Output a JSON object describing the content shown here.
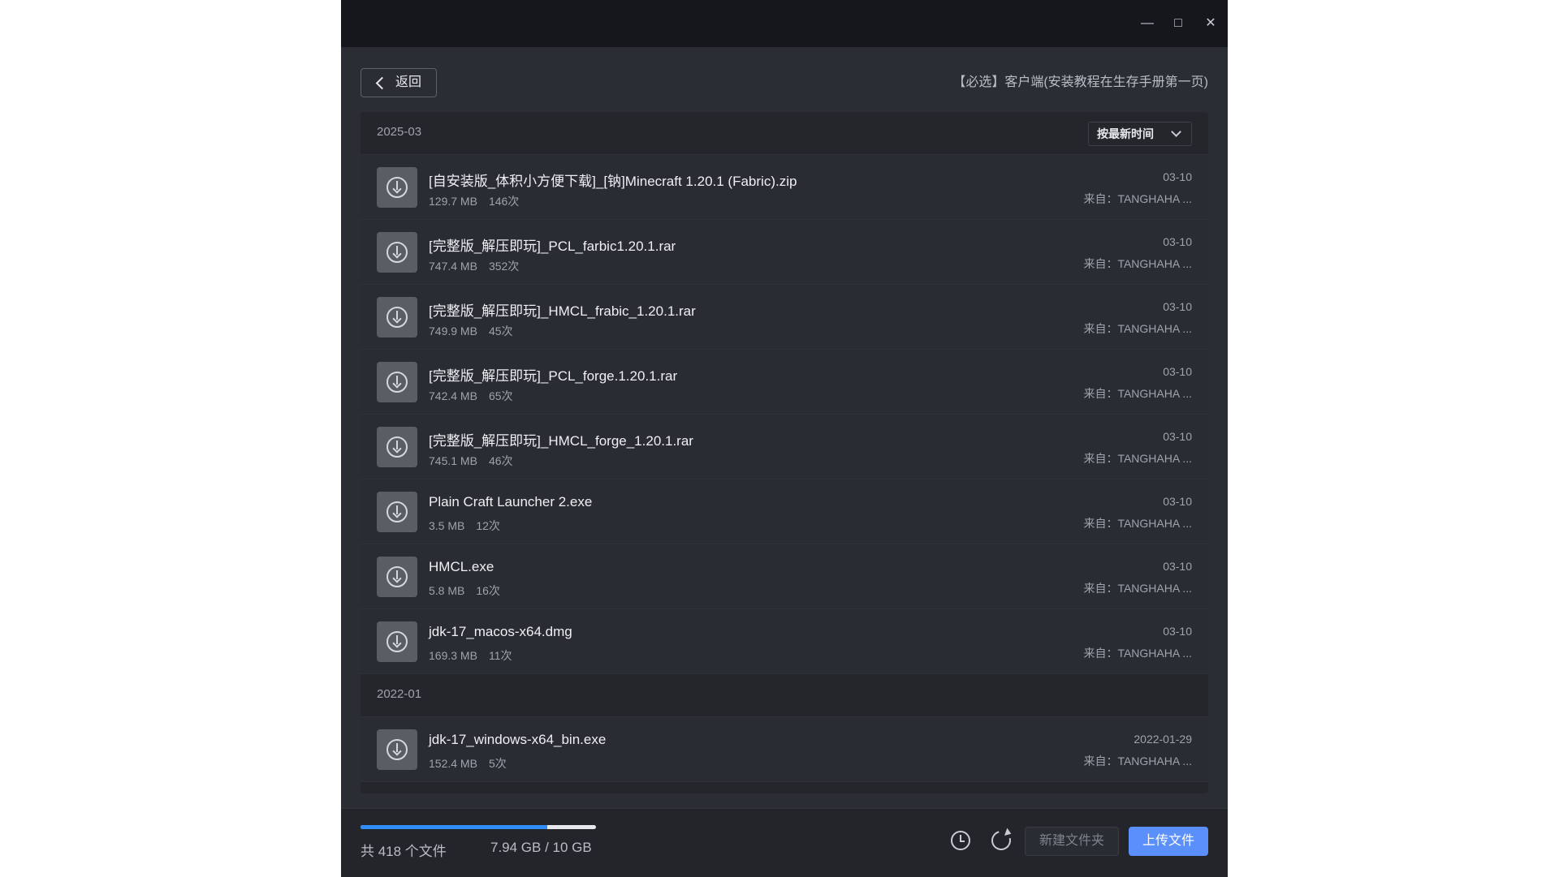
{
  "window": {
    "minimize_icon": "minimize-icon",
    "maximize_icon": "maximize-icon",
    "close_icon": "close-icon"
  },
  "header": {
    "back_label": "返回",
    "folder_path": "【必选】客户端(安装教程在生存手册第一页)"
  },
  "sort": {
    "selected": "按最新时间"
  },
  "groups": [
    {
      "label": "2025-03",
      "files": [
        {
          "name": "[自安装版_体积小方便下载]_[钠]Minecraft 1.20.1 (Fabric).zip",
          "size": "129.7 MB",
          "downloads": "146次",
          "date": "03-10",
          "source": "来自：TANGHAHA ..."
        },
        {
          "name": "[完整版_解压即玩]_PCL_farbic1.20.1.rar",
          "size": "747.4 MB",
          "downloads": "352次",
          "date": "03-10",
          "source": "来自：TANGHAHA ..."
        },
        {
          "name": "[完整版_解压即玩]_HMCL_frabic_1.20.1.rar",
          "size": "749.9 MB",
          "downloads": "45次",
          "date": "03-10",
          "source": "来自：TANGHAHA ..."
        },
        {
          "name": "[完整版_解压即玩]_PCL_forge.1.20.1.rar",
          "size": "742.4 MB",
          "downloads": "65次",
          "date": "03-10",
          "source": "来自：TANGHAHA ..."
        },
        {
          "name": "[完整版_解压即玩]_HMCL_forge_1.20.1.rar",
          "size": "745.1 MB",
          "downloads": "46次",
          "date": "03-10",
          "source": "来自：TANGHAHA ..."
        },
        {
          "name": "Plain Craft Launcher 2.exe",
          "size": "3.5 MB",
          "downloads": "12次",
          "date": "03-10",
          "source": "来自：TANGHAHA ..."
        },
        {
          "name": "HMCL.exe",
          "size": "5.8 MB",
          "downloads": "16次",
          "date": "03-10",
          "source": "来自：TANGHAHA ..."
        },
        {
          "name": "jdk-17_macos-x64.dmg",
          "size": "169.3 MB",
          "downloads": "11次",
          "date": "03-10",
          "source": "来自：TANGHAHA ..."
        }
      ]
    },
    {
      "label": "2022-01",
      "files": [
        {
          "name": "jdk-17_windows-x64_bin.exe",
          "size": "152.4 MB",
          "downloads": "5次",
          "date": "2022-01-29",
          "source": "来自：TANGHAHA ..."
        }
      ]
    }
  ],
  "footer": {
    "file_count": "共 418 个文件",
    "storage": "7.94 GB / 10 GB",
    "storage_used_fraction": 0.794,
    "history_icon": "history-icon",
    "refresh_icon": "refresh-icon",
    "new_folder_label": "新建文件夹",
    "upload_label": "上传文件"
  },
  "colors": {
    "accent": "#5b8ff9",
    "progress": "#2f8df5",
    "background": "#2b2d34"
  }
}
